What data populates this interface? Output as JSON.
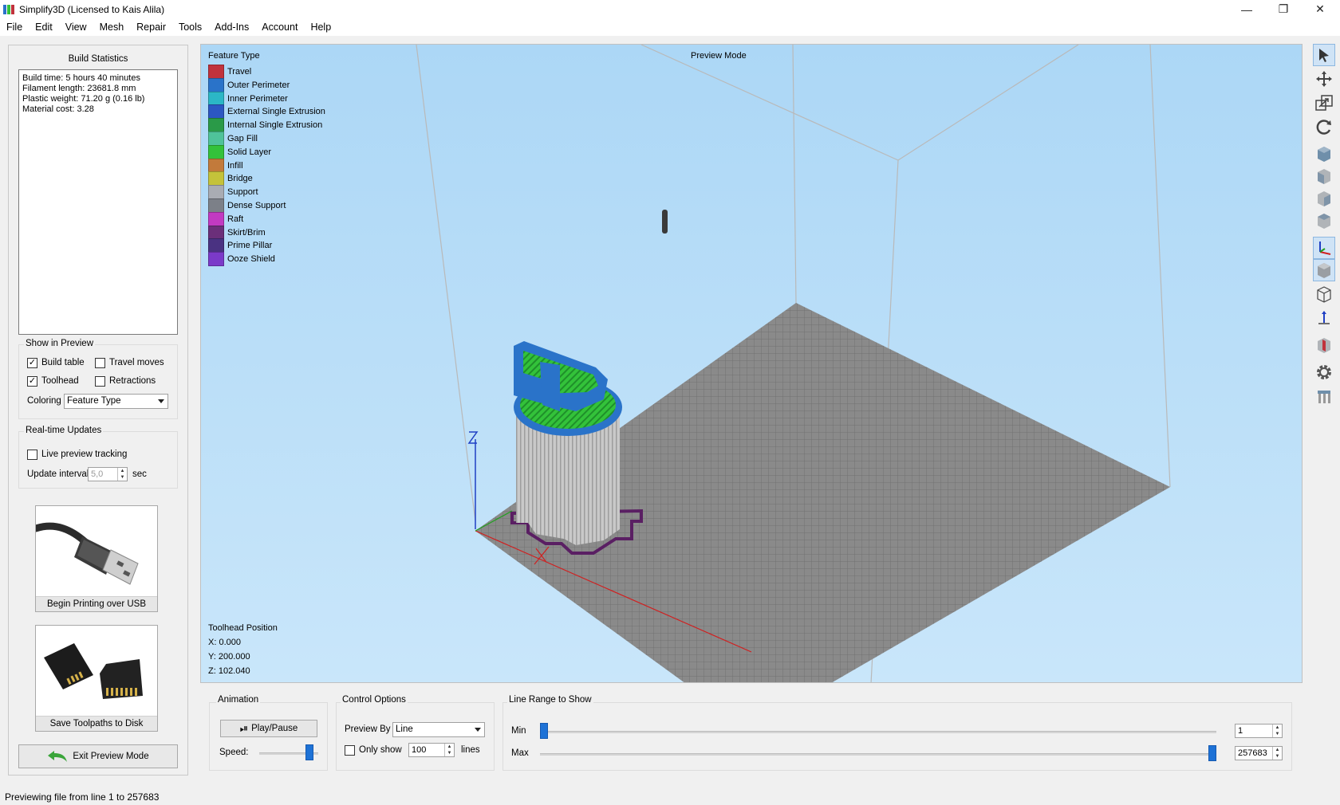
{
  "window": {
    "title": "Simplify3D (Licensed to Kais Alila)",
    "minimize_glyph": "—",
    "restore_glyph": "❐",
    "close_glyph": "✕"
  },
  "menu": [
    "File",
    "Edit",
    "View",
    "Mesh",
    "Repair",
    "Tools",
    "Add-Ins",
    "Account",
    "Help"
  ],
  "left": {
    "build_statistics_title": "Build Statistics",
    "stats": [
      "Build time: 5 hours 40 minutes",
      "Filament length: 23681.8 mm",
      "Plastic weight: 71.20 g (0.16 lb)",
      "Material cost: 3.28"
    ],
    "show_in_preview": {
      "title": "Show in Preview",
      "build_table": "Build table",
      "build_table_checked": true,
      "travel_moves": "Travel moves",
      "travel_moves_checked": false,
      "toolhead": "Toolhead",
      "toolhead_checked": true,
      "retractions": "Retractions",
      "retractions_checked": false,
      "coloring_label": "Coloring",
      "coloring_value": "Feature Type"
    },
    "realtime": {
      "title": "Real-time Updates",
      "live_tracking": "Live preview tracking",
      "live_tracking_checked": false,
      "interval_label": "Update interval",
      "interval_value": "5,0",
      "interval_unit": "sec"
    },
    "usb_button": "Begin Printing over USB",
    "disk_button": "Save Toolpaths to Disk",
    "exit_button": "Exit Preview Mode"
  },
  "viewport": {
    "mode_label": "Preview Mode",
    "legend_title": "Feature Type",
    "legend": [
      {
        "label": "Travel",
        "color": "#c0323c"
      },
      {
        "label": "Outer Perimeter",
        "color": "#2a73c9"
      },
      {
        "label": "Inner Perimeter",
        "color": "#2bb7c6"
      },
      {
        "label": "External Single Extrusion",
        "color": "#2c57c2"
      },
      {
        "label": "Internal Single Extrusion",
        "color": "#2a9a48"
      },
      {
        "label": "Gap Fill",
        "color": "#4fc39a"
      },
      {
        "label": "Solid Layer",
        "color": "#33c23a"
      },
      {
        "label": "Infill",
        "color": "#c27a3b"
      },
      {
        "label": "Bridge",
        "color": "#c4c23a"
      },
      {
        "label": "Support",
        "color": "#a9acb3"
      },
      {
        "label": "Dense Support",
        "color": "#7c8088"
      },
      {
        "label": "Raft",
        "color": "#c23ac2"
      },
      {
        "label": "Skirt/Brim",
        "color": "#6b2f7a"
      },
      {
        "label": "Prime Pillar",
        "color": "#4a3282"
      },
      {
        "label": "Ooze Shield",
        "color": "#7b3ac9"
      }
    ],
    "toolhead_title": "Toolhead Position",
    "toolhead_x": "X: 0.000",
    "toolhead_y": "Y: 200.000",
    "toolhead_z": "Z: 102.040"
  },
  "bottom": {
    "animation": {
      "title": "Animation",
      "play_pause": "Play/Pause",
      "speed_label": "Speed:",
      "speed_fraction": 0.9
    },
    "control": {
      "title": "Control Options",
      "preview_by_label": "Preview By",
      "preview_by_value": "Line",
      "only_show_label": "Only show",
      "only_show_checked": false,
      "only_show_value": "100",
      "lines_label": "lines"
    },
    "line_range": {
      "title": "Line Range to Show",
      "min_label": "Min",
      "max_label": "Max",
      "min_value": "1",
      "max_value": "257683",
      "min_fraction": 0.0,
      "max_fraction": 1.0
    }
  },
  "status": "Previewing file from line 1 to 257683",
  "toolbar_icons": [
    "select-icon",
    "move-icon",
    "scale-icon",
    "rotate-icon",
    "view-default-icon",
    "view-front-icon",
    "view-side-icon",
    "view-top-icon",
    "axes-icon",
    "shaded-view-icon",
    "wireframe-view-icon",
    "axis-arrow-icon",
    "cross-section-icon",
    "settings-gear-icon",
    "support-icon"
  ],
  "colors": {
    "accent": "#1e72d6",
    "build_plate": "#8a8a8a",
    "outer_perimeter": "#2a73c9",
    "solid_layer": "#33c23a"
  }
}
